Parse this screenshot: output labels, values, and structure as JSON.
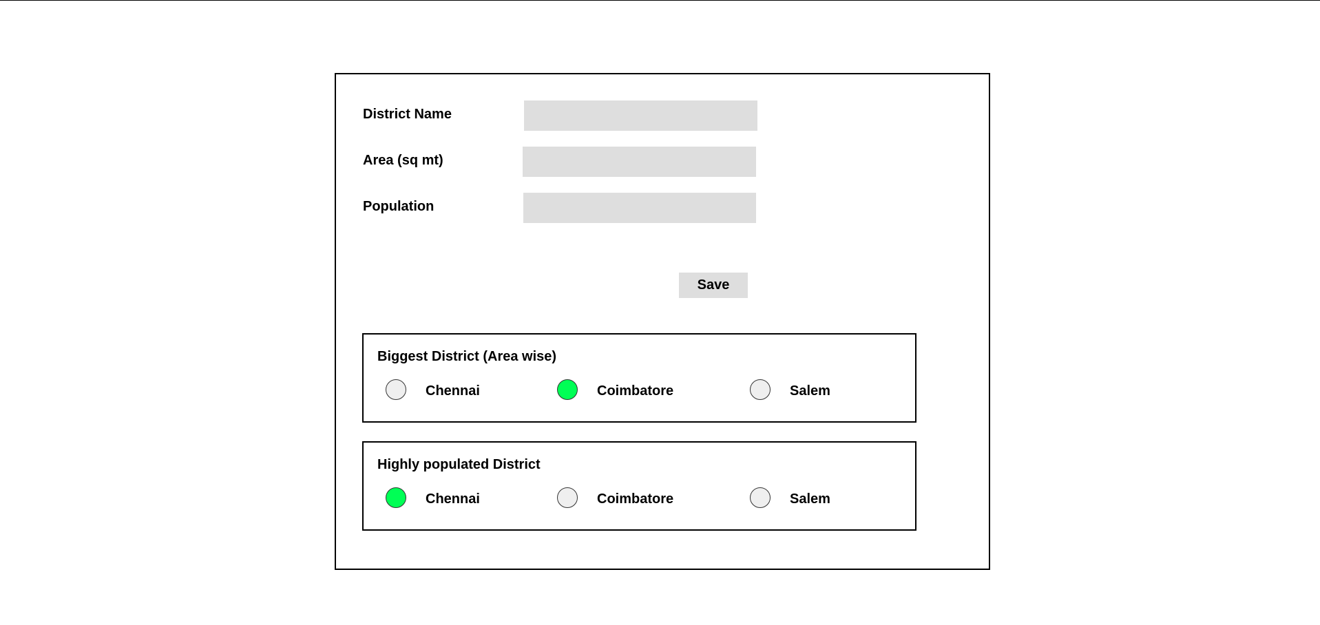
{
  "form": {
    "fields": [
      {
        "label": "District Name",
        "value": ""
      },
      {
        "label": "Area (sq mt)",
        "value": ""
      },
      {
        "label": "Population",
        "value": ""
      }
    ],
    "save_label": "Save"
  },
  "groups": [
    {
      "title": "Biggest District (Area wise)",
      "options": [
        {
          "label": "Chennai",
          "selected": false
        },
        {
          "label": "Coimbatore",
          "selected": true
        },
        {
          "label": "Salem",
          "selected": false
        }
      ]
    },
    {
      "title": "Highly populated District",
      "options": [
        {
          "label": "Chennai",
          "selected": true
        },
        {
          "label": "Coimbatore",
          "selected": false
        },
        {
          "label": "Salem",
          "selected": false
        }
      ]
    }
  ],
  "colors": {
    "selected_radio": "#00ff55",
    "unselected_radio": "#efefef",
    "input_background": "#dedede"
  }
}
